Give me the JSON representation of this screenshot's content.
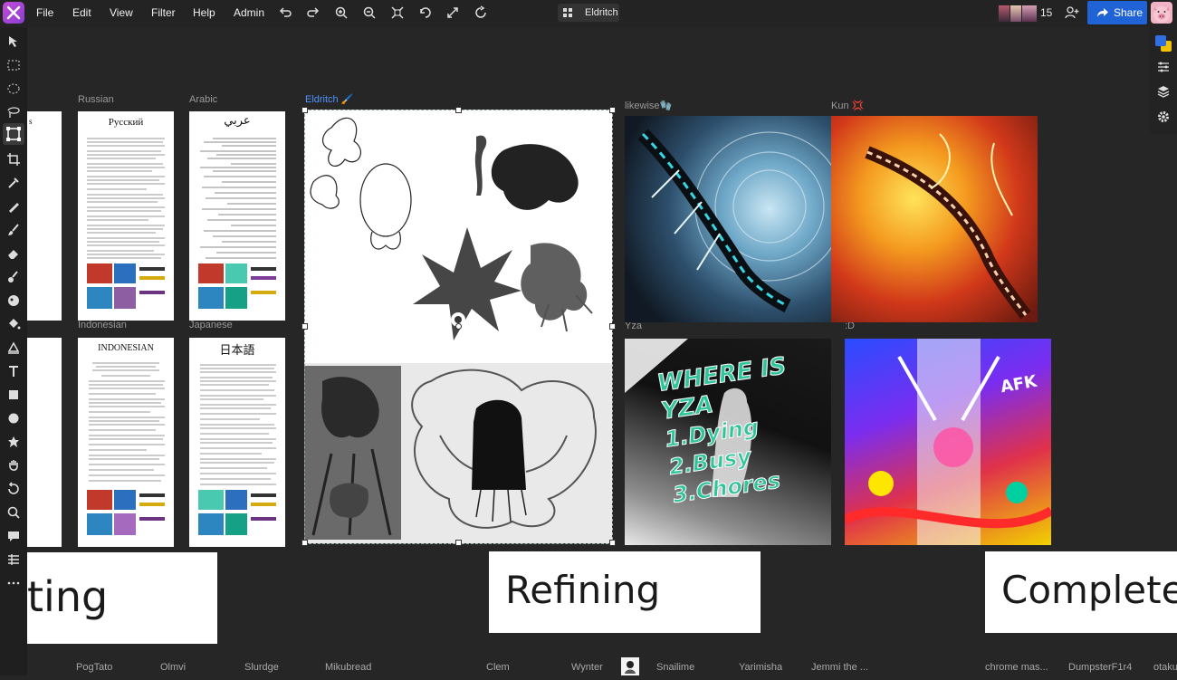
{
  "menu": [
    "File",
    "Edit",
    "View",
    "Filter",
    "Help",
    "Admin"
  ],
  "document_name": "Eldritch",
  "user_count": "15",
  "share_label": "Share",
  "board_labels": {
    "russian": "Russian",
    "arabic": "Arabic",
    "indonesian": "Indonesian",
    "japanese": "Japanese",
    "eldritch": "Eldritch 🖌️",
    "likewise": "likewise🧤",
    "kun": "Kun 💢",
    "yza": "Yza",
    "smile": ":D"
  },
  "doc_titles": {
    "russian": "Русский",
    "arabic": "عربي",
    "indonesian": "INDONESIAN",
    "japanese": "日本語"
  },
  "yza_art_text": [
    "WHERE IS",
    "YZA",
    "1.Dying",
    "2.Busy",
    "3.Chores"
  ],
  "smile_art_text": "AFK",
  "stickies": {
    "left": "ting",
    "middle": "Refining",
    "right": "Complete"
  },
  "bottom_names": [
    "PogTato",
    "Olmvi",
    "Slurdge",
    "Mikubread",
    "Clem",
    "Wynter",
    "Snailime",
    "Yarimisha",
    "Jemmi the ...",
    "chrome mas...",
    "DumpsterF1r4",
    "otaku"
  ],
  "colors": {
    "background": "#262626",
    "toolbar": "#1f1f1f",
    "accent_blue": "#1f63d6",
    "selection_label": "#4d94ff"
  }
}
